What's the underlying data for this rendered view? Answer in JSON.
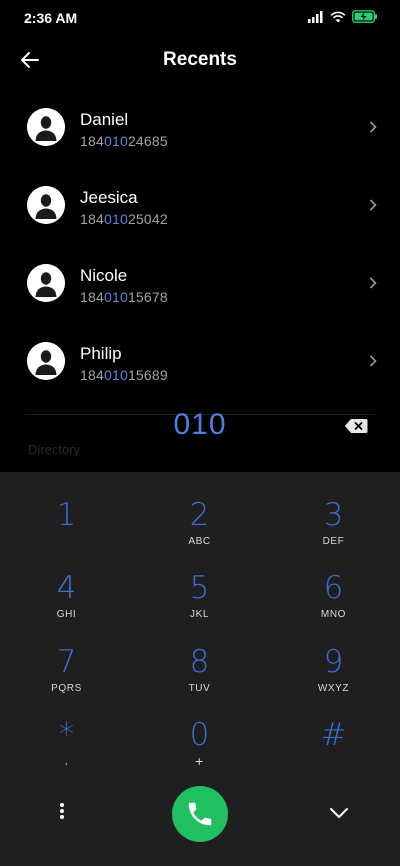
{
  "status": {
    "time": "2:36 AM",
    "icons": [
      "signal-icon",
      "wifi-icon",
      "battery-charging-icon"
    ]
  },
  "header": {
    "title": "Recents",
    "back_icon": "arrow-left-icon"
  },
  "contacts": [
    {
      "name": "Daniel",
      "number_prefix": "184",
      "number_match": "010",
      "number_suffix": "24685"
    },
    {
      "name": "Jeesica",
      "number_prefix": "184",
      "number_match": "010",
      "number_suffix": "25042"
    },
    {
      "name": "Nicole",
      "number_prefix": "184",
      "number_match": "010",
      "number_suffix": "15678"
    },
    {
      "name": "Philip",
      "number_prefix": "184",
      "number_match": "010",
      "number_suffix": "15689"
    }
  ],
  "dial": {
    "value": "010",
    "ghost_label": "Directory"
  },
  "keypad": {
    "keys": [
      {
        "digit": "1",
        "letters": ""
      },
      {
        "digit": "2",
        "letters": "ABC"
      },
      {
        "digit": "3",
        "letters": "DEF"
      },
      {
        "digit": "4",
        "letters": "GHI"
      },
      {
        "digit": "5",
        "letters": "JKL"
      },
      {
        "digit": "6",
        "letters": "MNO"
      },
      {
        "digit": "7",
        "letters": "PQRS"
      },
      {
        "digit": "8",
        "letters": "TUV"
      },
      {
        "digit": "9",
        "letters": "WXYZ"
      },
      {
        "digit": "*",
        "letters": ","
      },
      {
        "digit": "0",
        "letters": "+"
      },
      {
        "digit": "#",
        "letters": ""
      }
    ]
  },
  "colors": {
    "accent": "#3c6ed6",
    "call_green": "#20c060",
    "keypad_bg": "#1f1f1f"
  }
}
